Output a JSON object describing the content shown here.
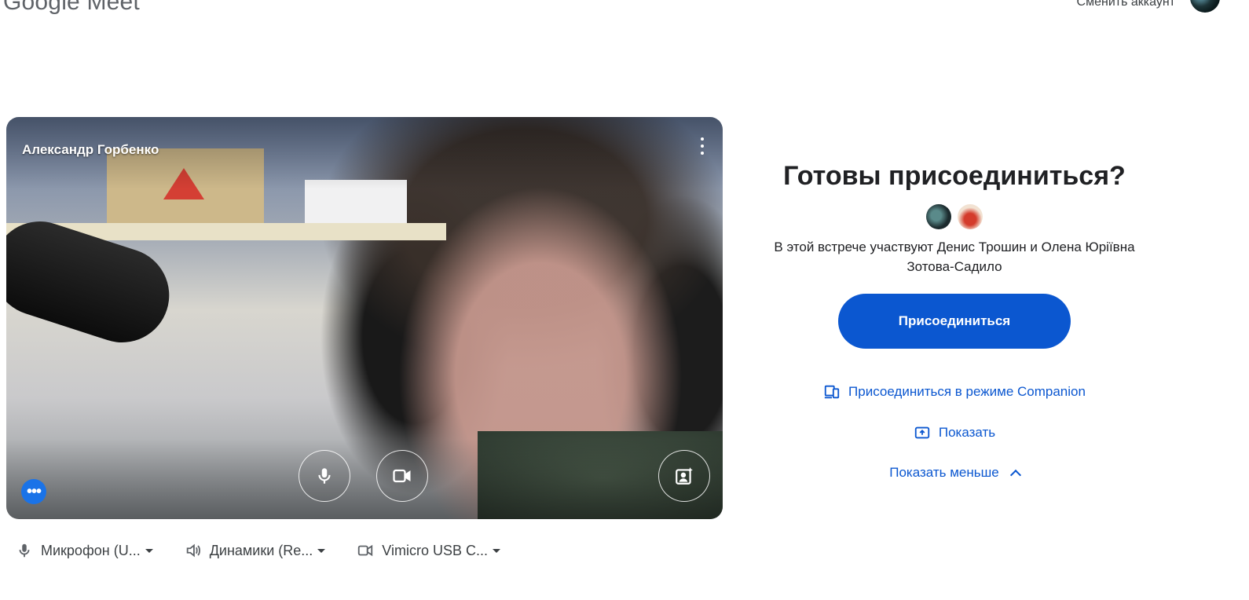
{
  "header": {
    "logo_text": "Google Meet",
    "switch_account": "Сменить аккаунт"
  },
  "preview": {
    "user_name": "Александр Горбенко"
  },
  "devices": [
    {
      "icon": "microphone-icon",
      "label": "Микрофон (U..."
    },
    {
      "icon": "speaker-icon",
      "label": "Динамики (Re..."
    },
    {
      "icon": "video-camera-icon",
      "label": "Vimicro USB C..."
    }
  ],
  "join_panel": {
    "title": "Готовы присоединиться?",
    "in_call_text": "В этой встрече участвуют Денис Трошин и Олена Юріївна Зотова-Садило",
    "join_button": "Присоединиться",
    "companion_link": "Присоединиться в режиме Companion",
    "present_link": "Показать",
    "show_less": "Показать меньше"
  },
  "colors": {
    "primary": "#0b57d0",
    "accent_dot": "#1a73e8"
  }
}
